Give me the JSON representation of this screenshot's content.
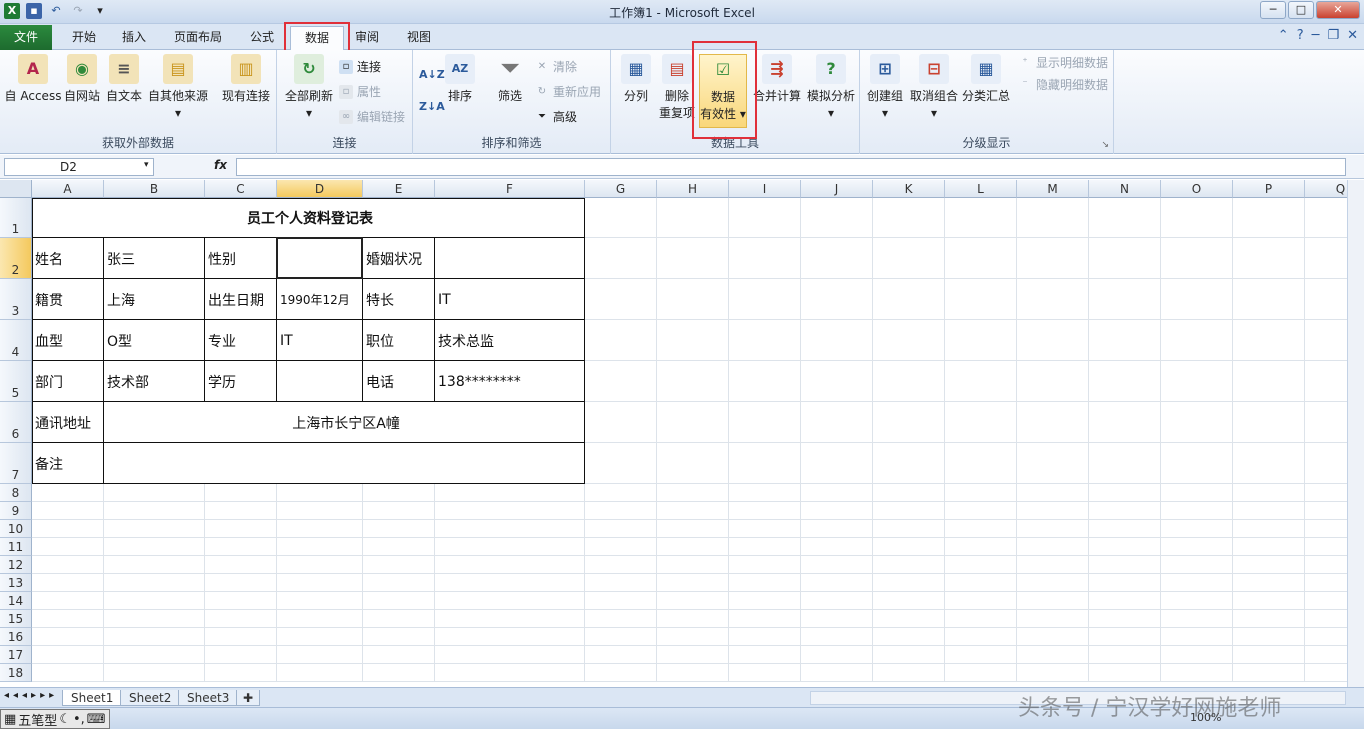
{
  "window": {
    "title": "工作簿1 - Microsoft Excel"
  },
  "tabs": [
    {
      "label": "文件"
    },
    {
      "label": "开始"
    },
    {
      "label": "插入"
    },
    {
      "label": "页面布局"
    },
    {
      "label": "公式"
    },
    {
      "label": "数据"
    },
    {
      "label": "审阅"
    },
    {
      "label": "视图"
    }
  ],
  "ribbon": {
    "external": {
      "label": "获取外部数据",
      "access": "自 Access",
      "web": "自网站",
      "text": "自文本",
      "other": "自其他来源",
      "existing": "现有连接"
    },
    "connections": {
      "label": "连接",
      "refresh": "全部刷新",
      "conn": "连接",
      "props": "属性",
      "edit": "编辑链接"
    },
    "sort": {
      "label": "排序和筛选",
      "sort": "排序",
      "filter": "筛选",
      "clear": "清除",
      "reapply": "重新应用",
      "advanced": "高级"
    },
    "tools": {
      "label": "数据工具",
      "split": "分列",
      "remove1": "删除",
      "remove2": "重复项",
      "valid1": "数据",
      "valid2": "有效性",
      "consolidate": "合并计算",
      "whatif": "模拟分析"
    },
    "outline": {
      "label": "分级显示",
      "group": "创建组",
      "ungroup": "取消组合",
      "subtotal": "分类汇总",
      "show": "显示明细数据",
      "hide": "隐藏明细数据"
    }
  },
  "formula": {
    "namebox": "D2",
    "fx": "fx",
    "content": ""
  },
  "columns": [
    "A",
    "B",
    "C",
    "D",
    "E",
    "F",
    "G",
    "H",
    "I",
    "J",
    "K",
    "L",
    "M",
    "N",
    "O",
    "P",
    "Q"
  ],
  "rows": [
    "1",
    "2",
    "3",
    "4",
    "5",
    "6",
    "7",
    "8",
    "9",
    "10",
    "11",
    "12",
    "13",
    "14",
    "15",
    "16",
    "17",
    "18"
  ],
  "form": {
    "title": "员工个人资料登记表",
    "r2": [
      "姓名",
      "张三",
      "性别",
      "",
      "婚姻状况",
      ""
    ],
    "r3": [
      "籍贯",
      "上海",
      "出生日期",
      "1990年12月",
      "特长",
      "IT"
    ],
    "r4": [
      "血型",
      "O型",
      "专业",
      "IT",
      "职位",
      "技术总监"
    ],
    "r5": [
      "部门",
      "技术部",
      "学历",
      "",
      "电话",
      "138********"
    ],
    "r6_label": "通讯地址",
    "r6_value": "上海市长宁区A幢",
    "r7_label": "备注"
  },
  "sheets": [
    "Sheet1",
    "Sheet2",
    "Sheet3"
  ],
  "status": {
    "ime": "五笔型",
    "zoom": "100%"
  },
  "watermark": "头条号 / 宁汉学好网施老师"
}
